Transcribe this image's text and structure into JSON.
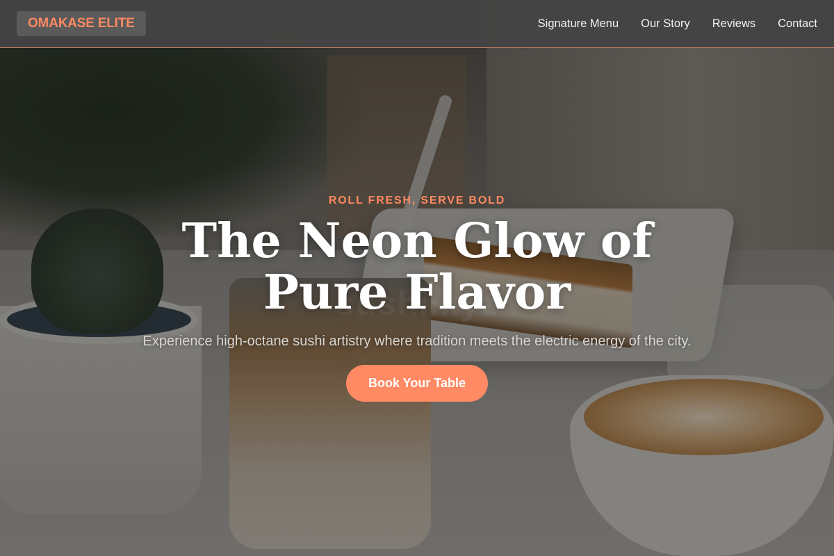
{
  "brand": {
    "name": "OMAKASE ELITE",
    "color": "#ff8a63"
  },
  "nav": {
    "links": [
      {
        "label": "Signature Menu"
      },
      {
        "label": "Our Story"
      },
      {
        "label": "Reviews"
      },
      {
        "label": "Contact"
      }
    ]
  },
  "hero": {
    "eyebrow": "ROLL FRESH, SERVE BOLD",
    "headline": "The Neon Glow of Pure Flavor",
    "subheadline": "Experience high-octane sushi artistry where tradition meets the electric energy of the city.",
    "cta_label": "Book Your Table",
    "watermark": "sushi.xyz",
    "accent_color": "#ff8a63"
  }
}
